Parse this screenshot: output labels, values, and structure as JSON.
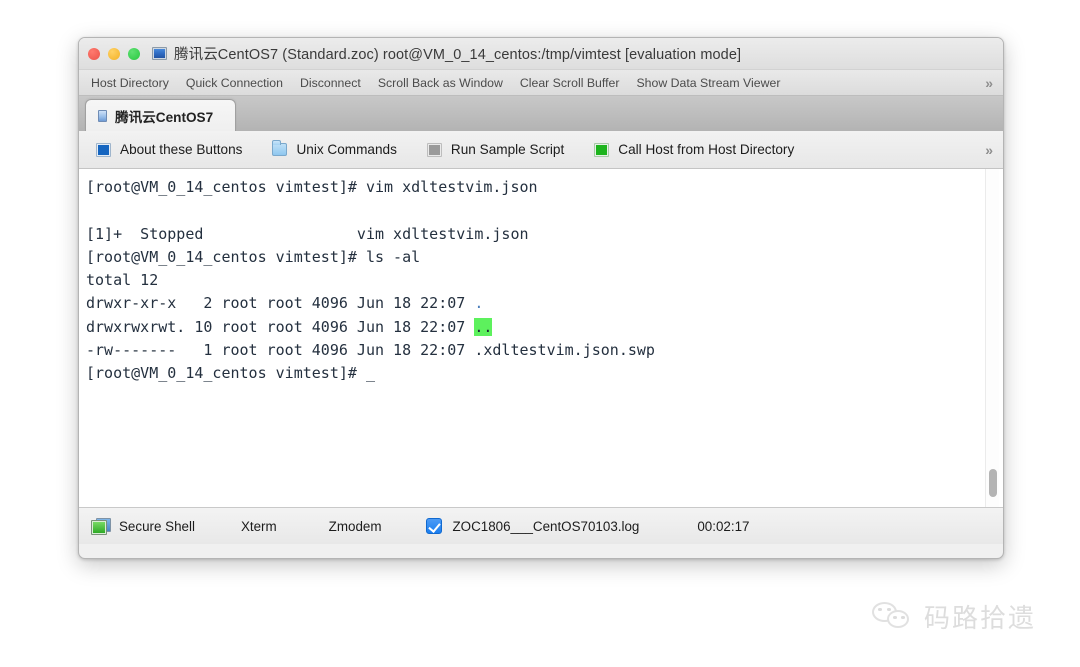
{
  "window": {
    "title": "腾讯云CentOS7 (Standard.zoc) root@VM_0_14_centos:/tmp/vimtest [evaluation mode]",
    "icon": "monitor-icon",
    "traffic_lights": [
      "close-red",
      "minimize-yellow",
      "maximize-green"
    ],
    "colors": {
      "accent_blue": "#1a7ef0",
      "terminal_text": "#24303f",
      "dir_highlight_green": "#5df15d",
      "dir_text_blue": "#4a7ebb"
    }
  },
  "command_bar": {
    "items": [
      {
        "label": "Host Directory"
      },
      {
        "label": "Quick Connection"
      },
      {
        "label": "Disconnect"
      },
      {
        "label": "Scroll Back as Window"
      },
      {
        "label": "Clear Scroll Buffer"
      },
      {
        "label": "Show Data Stream Viewer"
      }
    ],
    "overflow_label": "»"
  },
  "tabs": [
    {
      "label": "腾讯云CentOS7",
      "icon": "document-icon",
      "active": true
    }
  ],
  "button_bar": {
    "buttons": [
      {
        "label": "About these Buttons",
        "icon": "blue-square-icon",
        "icon_style": "sq-blue"
      },
      {
        "label": "Unix Commands",
        "icon": "folder-icon",
        "icon_style": "folder"
      },
      {
        "label": "Run Sample Script",
        "icon": "gray-square-icon",
        "icon_style": "sq-gray"
      },
      {
        "label": "Call Host from Host Directory",
        "icon": "green-square-icon",
        "icon_style": "sq-green"
      }
    ],
    "overflow_label": "»"
  },
  "terminal": {
    "lines": [
      {
        "segments": [
          {
            "text": "[root@VM_0_14_centos vimtest]# vim xdltestvim.json"
          }
        ]
      },
      {
        "segments": [
          {
            "text": ""
          }
        ]
      },
      {
        "segments": [
          {
            "text": "[1]+  Stopped                 vim xdltestvim.json"
          }
        ]
      },
      {
        "segments": [
          {
            "text": "[root@VM_0_14_centos vimtest]# ls -al"
          }
        ]
      },
      {
        "segments": [
          {
            "text": "total 12"
          }
        ]
      },
      {
        "segments": [
          {
            "text": "drwxr-xr-x   2 root root 4096 Jun 18 22:07 "
          },
          {
            "text": ".",
            "style": "t-blue"
          }
        ]
      },
      {
        "segments": [
          {
            "text": "drwxrwxrwt. 10 root root 4096 Jun 18 22:07 "
          },
          {
            "text": "..",
            "style": "t-dirhl"
          }
        ]
      },
      {
        "segments": [
          {
            "text": "-rw-------   1 root root 4096 Jun 18 22:07 .xdltestvim.json.swp"
          }
        ]
      },
      {
        "segments": [
          {
            "text": "[root@VM_0_14_centos vimtest]# "
          },
          {
            "text": "_",
            "style": "t-cursor"
          }
        ]
      }
    ],
    "scrollbar": {
      "thumb_position": "bottom"
    }
  },
  "status_bar": {
    "connection_label": "Secure Shell",
    "connection_icon": "secure-shell-icon",
    "emulation_label": "Xterm",
    "transfer_label": "Zmodem",
    "log_checked": true,
    "log_filename": "ZOC1806___CentOS70103.log",
    "elapsed_time": "00:02:17"
  },
  "watermark": {
    "text": "码路拾遗",
    "icon": "wechat-icon"
  }
}
